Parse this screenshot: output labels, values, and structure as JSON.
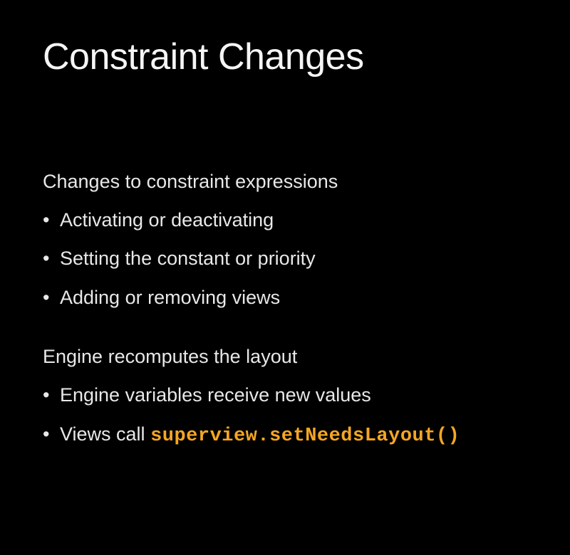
{
  "slide": {
    "title": "Constraint Changes",
    "sections": [
      {
        "heading": "Changes to constraint expressions",
        "bullets": [
          {
            "text": "Activating or deactivating"
          },
          {
            "text": "Setting the constant or priority"
          },
          {
            "text": "Adding or removing views"
          }
        ]
      },
      {
        "heading": "Engine recomputes the layout",
        "bullets": [
          {
            "text": "Engine variables receive new values"
          },
          {
            "text": "Views call ",
            "code": "superview.setNeedsLayout()"
          }
        ]
      }
    ]
  }
}
